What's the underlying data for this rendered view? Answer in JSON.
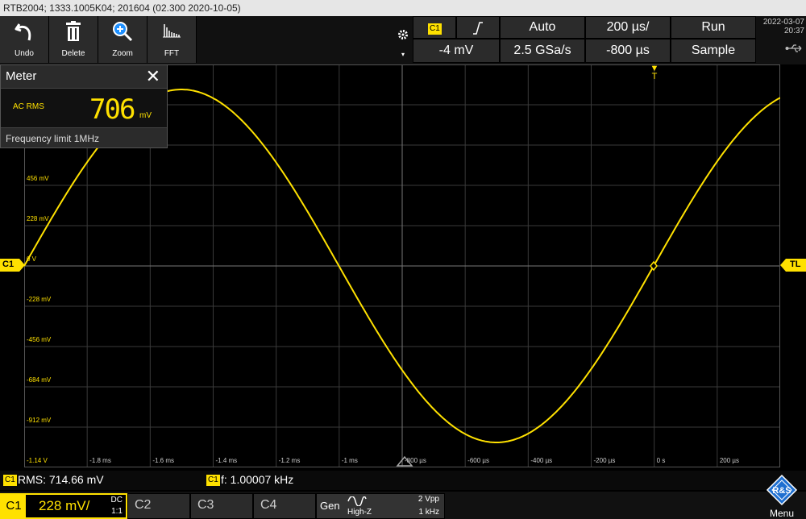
{
  "titlebar": {
    "text": "RTB2004; 1333.1005K04; 201604 (02.300 2020-10-05)"
  },
  "toolbar": {
    "undo_label": "Undo",
    "delete_label": "Delete",
    "zoom_label": "Zoom",
    "fft_label": "FFT"
  },
  "trigger": {
    "channel": "C1",
    "level": "-4 mV",
    "mode": "Auto",
    "sample_rate": "2.5 GSa/s",
    "timebase": "200 µs/",
    "position": "-800 µs",
    "run_state": "Run",
    "acquisition": "Sample"
  },
  "clock": {
    "date": "2022-03-07",
    "time": "20:37"
  },
  "meter": {
    "title": "Meter",
    "mode": "AC RMS",
    "value": "706",
    "unit": "mV",
    "freq_limit": "Frequency limit 1MHz"
  },
  "plot": {
    "y_labels": [
      "456 mV",
      "228 mV",
      "0 V",
      "-228 mV",
      "-456 mV",
      "-684 mV",
      "-912 mV",
      "-1.14 V"
    ],
    "x_labels": [
      "-1.8 ms",
      "-1.6 ms",
      "-1.4 ms",
      "-1.2 ms",
      "-1 ms",
      "-800 µs",
      "-600 µs",
      "-400 µs",
      "-200 µs",
      "0 s",
      "200 µs"
    ],
    "ch_marker": "C1",
    "trigger_marker": "T",
    "tl_marker": "TL",
    "trace_color": "#ffe100"
  },
  "measurements": {
    "rms_tag": "C1",
    "rms": "RMS: 714.66 mV",
    "freq_tag": "C1",
    "freq": "f: 1.00007 kHz"
  },
  "channels": {
    "c1": "C1",
    "c1_scale": "228 mV/",
    "c1_coupling": "DC",
    "c1_probe": "1:1",
    "c2": "C2",
    "c3": "C3",
    "c4": "C4"
  },
  "generator": {
    "label": "Gen",
    "impedance": "High-Z",
    "amplitude": "2 Vpp",
    "frequency": "1 kHz"
  },
  "menu": {
    "label": "Menu"
  }
}
